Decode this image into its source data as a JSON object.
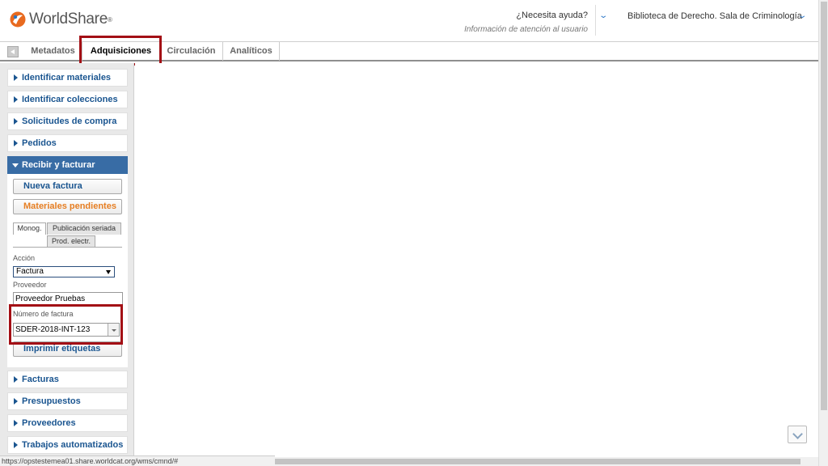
{
  "header": {
    "logo_text": "WorldShare",
    "help_title": "¿Necesita ayuda?",
    "help_subtitle": "Información de atención al usuario",
    "library": "Biblioteca de Derecho. Sala de Criminología"
  },
  "tabs": [
    {
      "label": "Metadatos"
    },
    {
      "label": "Adquisiciones"
    },
    {
      "label": "Circulación"
    },
    {
      "label": "Analíticos"
    }
  ],
  "sidebar": {
    "items": [
      {
        "label": "Identificar materiales"
      },
      {
        "label": "Identificar colecciones"
      },
      {
        "label": "Solicitudes de compra"
      },
      {
        "label": "Pedidos"
      },
      {
        "label": "Recibir y facturar"
      },
      {
        "label": "Facturas"
      },
      {
        "label": "Presupuestos"
      },
      {
        "label": "Proveedores"
      },
      {
        "label": "Trabajos automatizados"
      }
    ],
    "panel": {
      "new_invoice": "Nueva factura",
      "pending_items": "Materiales pendientes",
      "subtabs": [
        "Monog.",
        "Publicación seriada",
        "Prod. electr."
      ],
      "action_label": "Acción",
      "action_value": "Factura",
      "vendor_label": "Proveedor",
      "vendor_value": "Proveedor Pruebas",
      "invoice_number_label": "Número de factura",
      "invoice_number_value": "SDER-2018-INT-123",
      "print_labels": "Imprimir etiquetas"
    }
  },
  "status_url": "https://opstestemea01.share.worldcat.org/wms/cmnd/#",
  "colors": {
    "accent_blue": "#386ca5",
    "link_blue": "#1a5590",
    "orange": "#e67e22",
    "highlight_red": "#a30f15"
  }
}
